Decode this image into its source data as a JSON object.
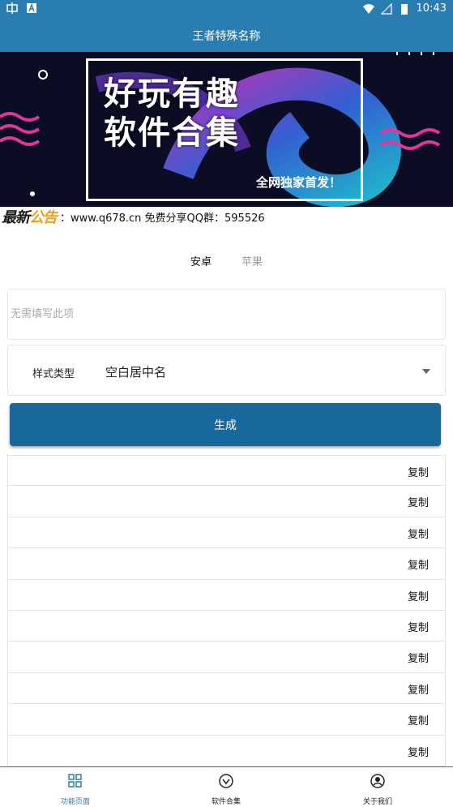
{
  "status_bar": {
    "time": "10:43"
  },
  "app_bar": {
    "title": "王者特殊名称"
  },
  "banner": {
    "title_line1": "好玩有趣",
    "title_line2": "软件合集",
    "subtitle": "全网独家首发！"
  },
  "notice": {
    "badge_a": "最新",
    "badge_b": "公告",
    "text": "：www.q678.cn 免费分享QQ群：595526"
  },
  "tabs": [
    {
      "label": "安卓",
      "active": true
    },
    {
      "label": "苹果",
      "active": false
    }
  ],
  "input": {
    "placeholder": "无需填写此项",
    "value": ""
  },
  "style_select": {
    "label": "样式类型",
    "value": "空白居中名"
  },
  "generate_button": "生成",
  "results": [
    {
      "text": "",
      "copy_label": "复制"
    },
    {
      "text": "",
      "copy_label": "复制"
    },
    {
      "text": "",
      "copy_label": "复制"
    },
    {
      "text": "",
      "copy_label": "复制"
    },
    {
      "text": "",
      "copy_label": "复制"
    },
    {
      "text": "",
      "copy_label": "复制"
    },
    {
      "text": "",
      "copy_label": "复制"
    },
    {
      "text": "",
      "copy_label": "复制"
    },
    {
      "text": "",
      "copy_label": "复制"
    },
    {
      "text": "",
      "copy_label": "复制"
    }
  ],
  "bottom_nav": [
    {
      "label": "功能页面",
      "icon": "grid-icon",
      "active": true
    },
    {
      "label": "软件合集",
      "icon": "collection-icon",
      "active": false
    },
    {
      "label": "关于我们",
      "icon": "about-icon",
      "active": false
    }
  ],
  "colors": {
    "primary": "#2a7db0",
    "button": "#19689c"
  }
}
